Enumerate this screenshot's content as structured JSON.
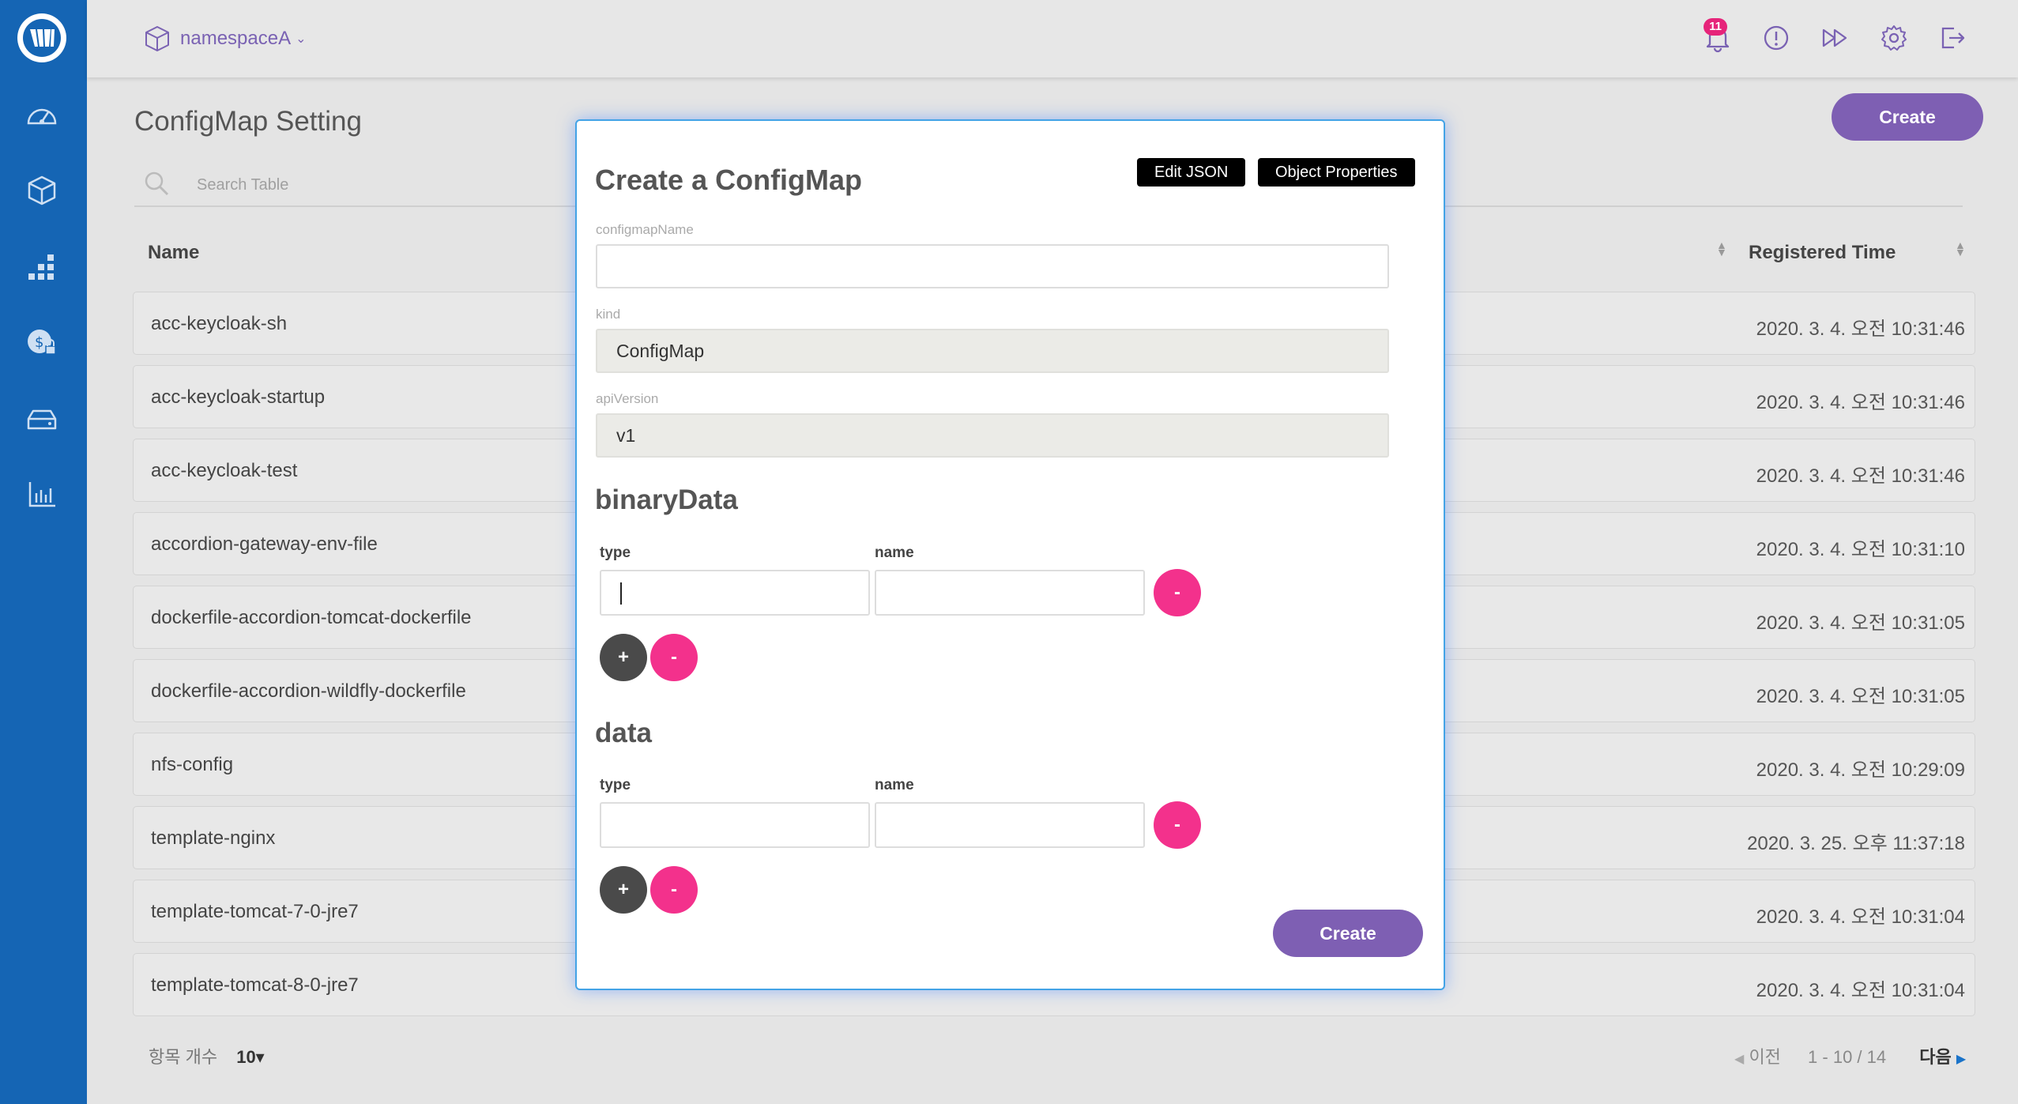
{
  "topbar": {
    "namespace": "namespaceA",
    "notification_count": "11"
  },
  "page": {
    "title": "ConfigMap Setting",
    "create_label": "Create",
    "search_placeholder": "Search Table",
    "col_name": "Name",
    "col_time": "Registered Time"
  },
  "rows": [
    {
      "name": "acc-keycloak-sh",
      "time": "2020. 3. 4. 오전 10:31:46"
    },
    {
      "name": "acc-keycloak-startup",
      "time": "2020. 3. 4. 오전 10:31:46"
    },
    {
      "name": "acc-keycloak-test",
      "time": "2020. 3. 4. 오전 10:31:46"
    },
    {
      "name": "accordion-gateway-env-file",
      "time": "2020. 3. 4. 오전 10:31:10"
    },
    {
      "name": "dockerfile-accordion-tomcat-dockerfile",
      "time": "2020. 3. 4. 오전 10:31:05"
    },
    {
      "name": "dockerfile-accordion-wildfly-dockerfile",
      "time": "2020. 3. 4. 오전 10:31:05"
    },
    {
      "name": "nfs-config",
      "time": "2020. 3. 4. 오전 10:29:09"
    },
    {
      "name": "template-nginx",
      "time": "2020. 3. 25. 오후 11:37:18"
    },
    {
      "name": "template-tomcat-7-0-jre7",
      "time": "2020. 3. 4. 오전 10:31:04"
    },
    {
      "name": "template-tomcat-8-0-jre7",
      "time": "2020. 3. 4. 오전 10:31:04"
    }
  ],
  "footer": {
    "items_label": "항목 개수",
    "items_count": "10▾",
    "prev": "이전",
    "range": "1 - 10 / 14",
    "next": "다음"
  },
  "modal": {
    "title": "Create a ConfigMap",
    "edit_json": "Edit JSON",
    "object_properties": "Object Properties",
    "name_label": "configmapName",
    "name_value": "",
    "kind_label": "kind",
    "kind_value": "ConfigMap",
    "api_label": "apiVersion",
    "api_value": "v1",
    "binary_title": "binaryData",
    "data_title": "data",
    "type_label": "type",
    "key_name_label": "name",
    "add": "+",
    "remove": "-",
    "create_label": "Create"
  }
}
